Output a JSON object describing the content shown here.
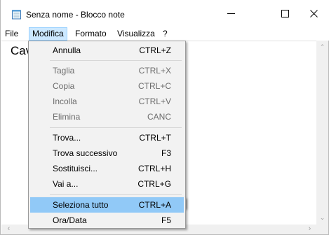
{
  "window": {
    "title": "Senza nome - Blocco note",
    "icon": "notepad-icon"
  },
  "menubar": {
    "items": [
      "File",
      "Modifica",
      "Formato",
      "Visualizza",
      "?"
    ],
    "active": "Modifica"
  },
  "editor": {
    "text": "Cav"
  },
  "edit_menu": {
    "items": [
      {
        "label": "Annulla",
        "shortcut": "CTRL+Z",
        "enabled": true
      },
      {
        "label": "Taglia",
        "shortcut": "CTRL+X",
        "enabled": false
      },
      {
        "label": "Copia",
        "shortcut": "CTRL+C",
        "enabled": false
      },
      {
        "label": "Incolla",
        "shortcut": "CTRL+V",
        "enabled": false
      },
      {
        "label": "Elimina",
        "shortcut": "CANC",
        "enabled": false
      },
      {
        "label": "Trova...",
        "shortcut": "CTRL+T",
        "enabled": true
      },
      {
        "label": "Trova successivo",
        "shortcut": "F3",
        "enabled": true
      },
      {
        "label": "Sostituisci...",
        "shortcut": "CTRL+H",
        "enabled": true
      },
      {
        "label": "Vai a...",
        "shortcut": "CTRL+G",
        "enabled": true
      },
      {
        "label": "Seleziona tutto",
        "shortcut": "CTRL+A",
        "enabled": true,
        "highlighted": true
      },
      {
        "label": "Ora/Data",
        "shortcut": "F5",
        "enabled": true
      }
    ]
  },
  "colors": {
    "highlight": "#91c9f7",
    "menu_active": "#cce8ff",
    "disabled_text": "#6d6d6d"
  }
}
